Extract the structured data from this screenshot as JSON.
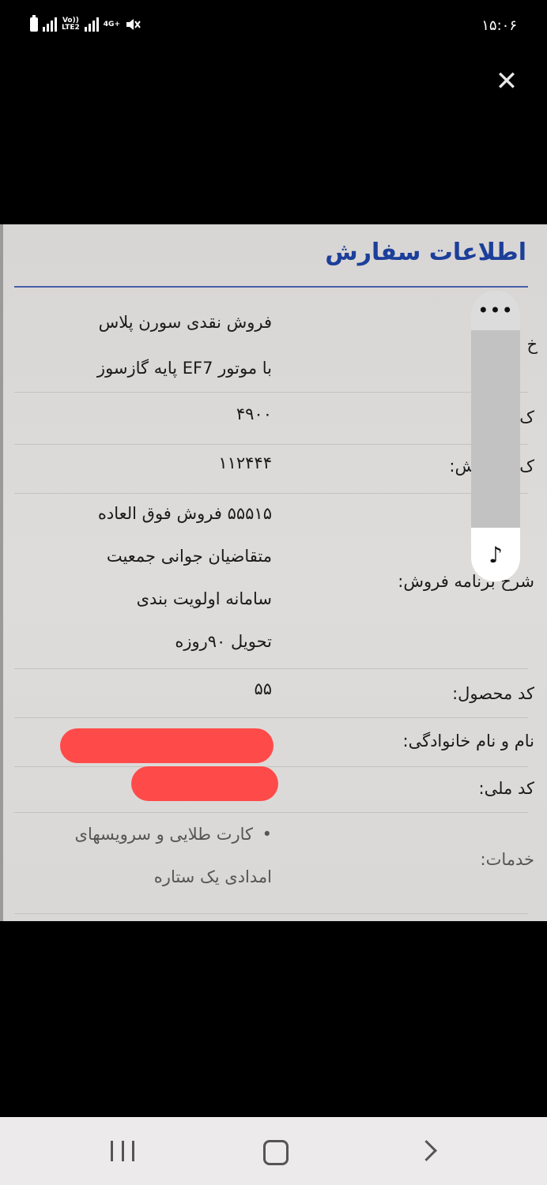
{
  "status_bar": {
    "net1": "Vo))",
    "net2": "LTE2",
    "net3": "4G+",
    "time": "۱۵:۰۶"
  },
  "viewer": {
    "close_glyph": "✕"
  },
  "photo": {
    "title": "اطلاعات سفارش",
    "rows": {
      "product_line1": "فروش نقدی سورن پلاس",
      "product_line2": "با موتور EF7 پایه گازسوز",
      "program_code_value": "۴۹۰۰",
      "program_code_label": "ک   نامه:",
      "sale_code_value": "۱۱۲۴۴۴",
      "sale_code_label": "ک   ه فروش:",
      "desc_line1": "۵۵۵۱۵ فروش فوق العاده",
      "desc_line2": "متقاضیان جوانی جمعیت",
      "desc_line3": "سامانه اولویت بندی",
      "desc_line4": "تحویل ۹۰روزه",
      "desc_label": "شرح برنامه فروش:",
      "product_code_value": "۵۵",
      "product_code_label": "کد محصول:",
      "name_label": "نام و نام خانوادگی:",
      "national_id_label": "کد ملی:",
      "services_line1": "کارت طلایی و سرویسهای",
      "services_line2": "امدادی یک ستاره",
      "services_label": "خدمات:",
      "partial_label_top": "خ"
    }
  },
  "overlay": {
    "menu_glyph": "•••",
    "music_glyph": "♪"
  },
  "nav": {
    "recent_icon": "recent-apps-icon",
    "home_icon": "home-icon",
    "back_icon": "back-icon"
  },
  "colors": {
    "title": "#1c3f9a",
    "redaction": "#ff4a4a"
  }
}
